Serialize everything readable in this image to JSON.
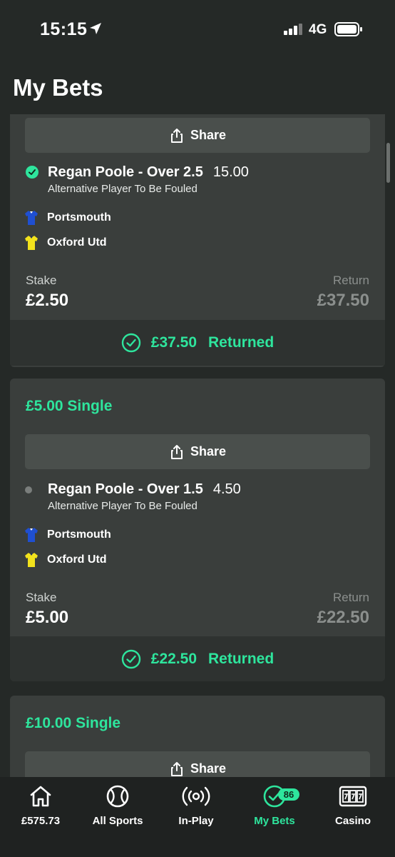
{
  "status_bar": {
    "time": "15:15",
    "network": "4G"
  },
  "header": {
    "title": "My Bets"
  },
  "cards": [
    {
      "share_label": "Share",
      "selection": {
        "name": "Regan Poole - Over 2.5",
        "odds": "15.00",
        "market": "Alternative Player To Be Fouled",
        "status": "won"
      },
      "teams": [
        {
          "name": "Portsmouth",
          "kit_color": "#1f4fd1"
        },
        {
          "name": "Oxford Utd",
          "kit_color": "#f2e21c"
        }
      ],
      "stake_label": "Stake",
      "stake": "£2.50",
      "return_label": "Return",
      "return": "£37.50",
      "returned_amount": "£37.50",
      "returned_text": "Returned"
    },
    {
      "title": "£5.00 Single",
      "share_label": "Share",
      "selection": {
        "name": "Regan Poole - Over 1.5",
        "odds": "4.50",
        "market": "Alternative Player To Be Fouled",
        "status": "open"
      },
      "teams": [
        {
          "name": "Portsmouth",
          "kit_color": "#1f4fd1"
        },
        {
          "name": "Oxford Utd",
          "kit_color": "#f2e21c"
        }
      ],
      "stake_label": "Stake",
      "stake": "£5.00",
      "return_label": "Return",
      "return": "£22.50",
      "returned_amount": "£22.50",
      "returned_text": "Returned"
    },
    {
      "title": "£10.00 Single",
      "share_label": "Share"
    }
  ],
  "nav": {
    "items": [
      {
        "label": "£575.73",
        "icon": "home-icon"
      },
      {
        "label": "All Sports",
        "icon": "ball-icon"
      },
      {
        "label": "In-Play",
        "icon": "broadcast-icon"
      },
      {
        "label": "My Bets",
        "icon": "check-circle-icon",
        "badge": "86",
        "active": true
      },
      {
        "label": "Casino",
        "icon": "slot-machine-icon"
      }
    ]
  },
  "colors": {
    "accent": "#2ee59d",
    "background": "#252927",
    "card": "#3a3e3c"
  }
}
